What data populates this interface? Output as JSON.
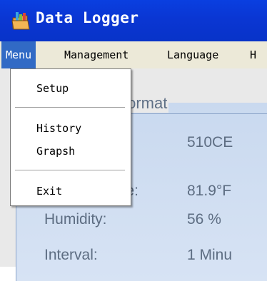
{
  "window": {
    "title": "Data Logger"
  },
  "menubar": {
    "items": [
      {
        "label": "Menu"
      },
      {
        "label": "Management"
      },
      {
        "label": "Language"
      },
      {
        "label": "H"
      }
    ]
  },
  "dropdown": {
    "items": [
      {
        "label": "Setup"
      },
      {
        "label": "History"
      },
      {
        "label": "Grapsh"
      },
      {
        "label": "Exit"
      }
    ]
  },
  "form": {
    "group_title": "format",
    "rows": [
      {
        "label": "",
        "value": "510CE"
      },
      {
        "label": "ture:",
        "value": "81.9°F"
      },
      {
        "label": "Humidity:",
        "value": "56 %"
      },
      {
        "label": "Interval:",
        "value": "1 Minu"
      }
    ]
  },
  "colors": {
    "titlebar": "#0a3fe0",
    "menu_highlight": "#316ac5",
    "group_background": "#d7e3f4",
    "label_text": "#5d6d82"
  },
  "icons": {
    "app": "folder-chart-icon"
  }
}
